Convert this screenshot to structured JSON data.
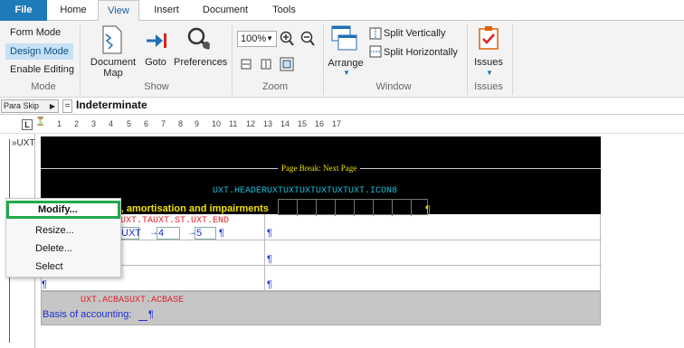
{
  "tabs": [
    {
      "label": "File"
    },
    {
      "label": "Home"
    },
    {
      "label": "View"
    },
    {
      "label": "Insert"
    },
    {
      "label": "Document"
    },
    {
      "label": "Tools"
    }
  ],
  "mode": {
    "items": [
      "Form Mode",
      "Design Mode",
      "Enable Editing"
    ],
    "group_label": "Mode"
  },
  "show": {
    "document_map": "Document Map",
    "goto": "Goto",
    "preferences": "Preferences",
    "group_label": "Show"
  },
  "zoom": {
    "value": "100%",
    "group_label": "Zoom"
  },
  "window": {
    "arrange": "Arrange",
    "split_vertically": "Split Vertically",
    "split_horizontally": "Split Horizontally",
    "group_label": "Window"
  },
  "issues": {
    "button": "Issues",
    "group_label": "Issues"
  },
  "formula_bar": {
    "style": "Para Skip",
    "equals": "=",
    "value": "Indeterminate"
  },
  "ruler": {
    "marks": [
      "1",
      "2",
      "3",
      "4",
      "5",
      "6",
      "7",
      "8",
      "9",
      "10",
      "11",
      "12",
      "13",
      "14",
      "15",
      "16",
      "17"
    ]
  },
  "editor": {
    "margin_tag": "»UXT",
    "page_break": "Page Break: Next Page",
    "header_field": "UXT.HEADERUXTUXTUXTUXTUXTUXT.ICON8",
    "heading_text": "n, amortisation and impairments",
    "pilcrow": "¶",
    "field_tau": "UXT.TAUXT.ST.UXT.END",
    "field_uxt": "UXT",
    "num4": "4",
    "num5": "5",
    "field_acbase": "UXT.ACBASUXT.ACBASE",
    "basis_text": "Basis of accounting:"
  },
  "context_menu": {
    "items": [
      "Modify...",
      "Resize...",
      "Delete...",
      "Select"
    ]
  },
  "colors": {
    "accent": "#1f7ab8",
    "highlight": "#22a84a",
    "field_red": "#e0202a",
    "text_blue": "#1a2fd0",
    "header_yellow": "#f0e000"
  }
}
